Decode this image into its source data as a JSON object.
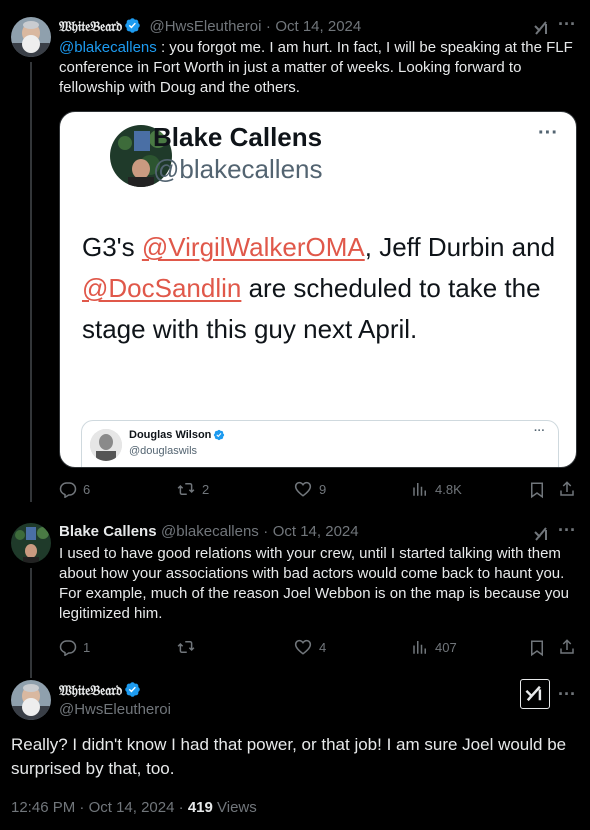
{
  "tweet1": {
    "display_name": "𝔚𝔥𝔦𝔱𝔢𝔅𝔢𝔞𝔯𝔡",
    "handle": "@HwsEleutheroi",
    "sep": "·",
    "date": "Oct 14, 2024",
    "mention": "@blakecallens",
    "text": " : you forgot me.  I am hurt.  In fact, I will be speaking at the FLF conference in Fort Worth in just a matter of weeks. Looking forward to fellowship with Doug and the others.",
    "replies": "6",
    "retweets": "2",
    "likes": "9",
    "views": "4.8K"
  },
  "embedded_card": {
    "name": "Blake Callens",
    "handle": "@blakecallens",
    "text_pre": "G3's ",
    "mention1": "@VirgilWalkerOMA",
    "text_mid1": ", Jeff Durbin and ",
    "mention2": "@DocSandlin",
    "text_post": " are scheduled to take the stage with this guy next April.",
    "inner_name": "Douglas Wilson",
    "inner_handle": "@douglaswils"
  },
  "tweet2": {
    "display_name": "Blake Callens",
    "handle": "@blakecallens",
    "sep": "·",
    "date": "Oct 14, 2024",
    "text": "I used to have good relations with your crew, until I started talking with them about how your associations with bad actors would come back to haunt you. For example, much of the reason Joel Webbon is on the map is because you legitimized him.",
    "replies": "1",
    "retweets": "",
    "likes": "4",
    "views": "407"
  },
  "tweet3": {
    "display_name": "𝔚𝔥𝔦𝔱𝔢𝔅𝔢𝔞𝔯𝔡",
    "handle": "@HwsEleutheroi",
    "text": "Really?  I didn't know I had that power, or that job!  I am sure Joel would be surprised by that, too.",
    "time": "12:46 PM",
    "sep": "·",
    "date": "Oct 14, 2024",
    "views_count": "419",
    "views_label": "Views"
  },
  "icons": {
    "more": "more-icon",
    "grok": "grok-icon",
    "reply": "reply-icon",
    "retweet": "retweet-icon",
    "like": "like-icon",
    "views": "views-icon",
    "bookmark": "bookmark-icon",
    "share": "share-icon",
    "verified": "verified-badge-icon"
  },
  "colors": {
    "background": "#000000",
    "text": "#e7e9ea",
    "muted": "#71767b",
    "link": "#1d9bf0",
    "verified": "#1d9bf0",
    "card_mention": "#e0584a"
  }
}
